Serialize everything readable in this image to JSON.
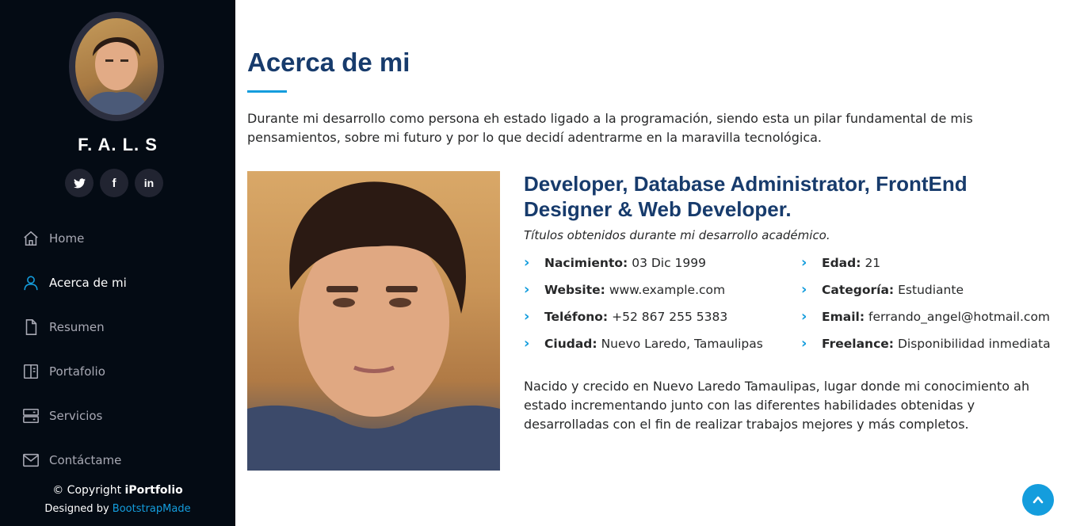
{
  "sidebar": {
    "brand": "F. A. L. S",
    "social": [
      {
        "icon": "twitter-icon",
        "glyph": ""
      },
      {
        "icon": "facebook-icon",
        "glyph": "f"
      },
      {
        "icon": "linkedin-icon",
        "glyph": "in"
      }
    ],
    "nav": [
      {
        "label": "Home",
        "icon": "home-icon"
      },
      {
        "label": "Acerca de mi",
        "icon": "person-icon",
        "active": true
      },
      {
        "label": "Resumen",
        "icon": "file-icon"
      },
      {
        "label": "Portafolio",
        "icon": "layout-icon"
      },
      {
        "label": "Servicios",
        "icon": "server-icon"
      },
      {
        "label": "Contáctame",
        "icon": "envelope-icon"
      }
    ],
    "footer": {
      "copyright_prefix": "© Copyright ",
      "copyright_name": "iPortfolio",
      "designed_prefix": "Designed by ",
      "designed_link": "BootstrapMade"
    }
  },
  "about": {
    "title": "Acerca de mi",
    "intro": "Durante mi desarrollo como persona eh estado ligado a la programación, siendo esta un pilar fundamental de mis pensamientos, sobre mi futuro y por lo que decidí adentrarme en la maravilla tecnológica.",
    "role": "Developer, Database Administrator, FrontEnd Designer & Web Developer.",
    "subtitle": "Títulos obtenidos durante mi desarrollo académico.",
    "info_left": [
      {
        "label": "Nacimiento:",
        "value": "03 Dic 1999"
      },
      {
        "label": "Website:",
        "value": "www.example.com"
      },
      {
        "label": "Teléfono:",
        "value": "+52 867 255 5383"
      },
      {
        "label": "Ciudad:",
        "value": "Nuevo Laredo, Tamaulipas"
      }
    ],
    "info_right": [
      {
        "label": "Edad:",
        "value": "21"
      },
      {
        "label": "Categoría:",
        "value": "Estudiante"
      },
      {
        "label": "Email:",
        "value": "ferrando_angel@hotmail.com"
      },
      {
        "label": "Freelance:",
        "value": "Disponibilidad inmediata"
      }
    ],
    "bio": "Nacido y crecido en Nuevo Laredo Tamaulipas, lugar donde mi conocimiento ah estado incrementando junto con las diferentes habilidades obtenidas y desarrolladas con el fin de realizar trabajos mejores y más completos."
  },
  "colors": {
    "sidebar_bg": "#040b14",
    "accent": "#149ddd",
    "heading": "#173b6c"
  }
}
